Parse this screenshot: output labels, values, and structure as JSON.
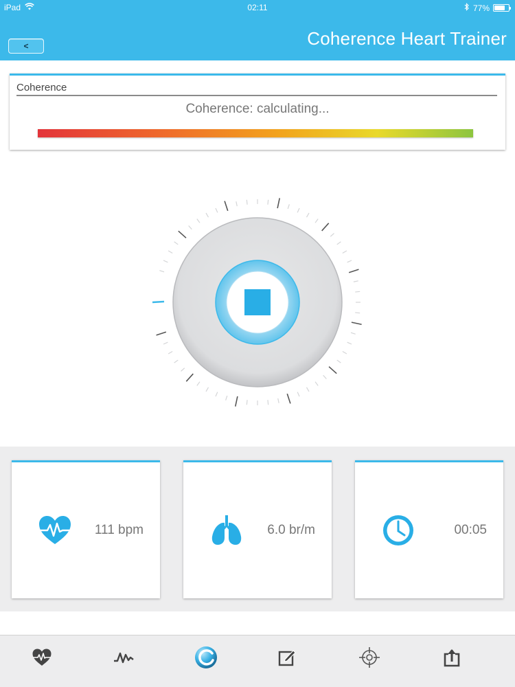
{
  "status_bar": {
    "device": "iPad",
    "time": "02:11",
    "battery": "77%",
    "battery_level": 0.77
  },
  "header": {
    "back_label": "<",
    "title": "Coherence Heart Trainer"
  },
  "coherence": {
    "heading": "Coherence",
    "status": "Coherence: calculating..."
  },
  "dial": {
    "state": "stop"
  },
  "stats": {
    "heart_rate": {
      "value": "111 bpm",
      "icon": "heart-icon"
    },
    "breathing_rate": {
      "value": "6.0 br/m",
      "icon": "lungs-icon"
    },
    "elapsed": {
      "value": "00:05",
      "icon": "clock-icon"
    }
  },
  "tabs": [
    {
      "icon": "heart-icon",
      "active": false
    },
    {
      "icon": "waveform-icon",
      "active": false
    },
    {
      "icon": "coherence-orb-icon",
      "active": true
    },
    {
      "icon": "edit-icon",
      "active": false
    },
    {
      "icon": "target-icon",
      "active": false
    },
    {
      "icon": "share-icon",
      "active": false
    }
  ],
  "colors": {
    "accent": "#3cb9ea",
    "bar_start": "#e3343a",
    "bar_end": "#8dc53f"
  }
}
